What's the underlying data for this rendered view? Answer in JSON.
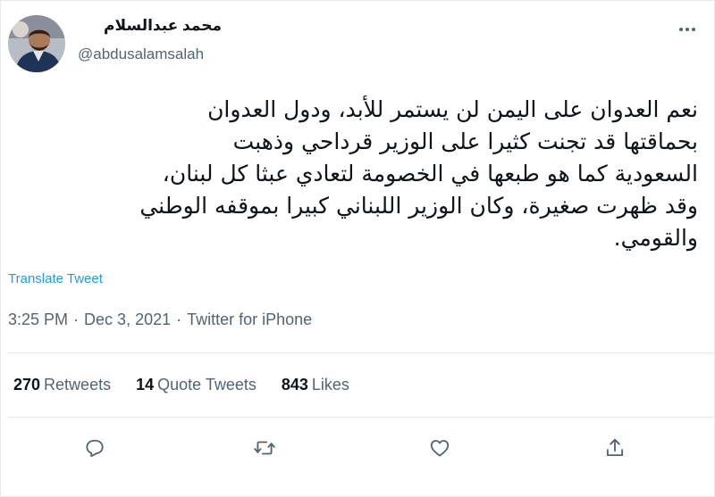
{
  "author": {
    "display_name": "محمد عبدالسلام",
    "handle": "@abdusalamsalah"
  },
  "tweet": {
    "text": "نعم العدوان على اليمن لن يستمر للأبد، ودول العدوان\nبحماقتها قد تجنت كثيرا على الوزير قرداحي وذهبت\nالسعودية كما هو طبعها في الخصومة لتعادي عبثا كل لبنان،\nوقد ظهرت صغيرة، وكان الوزير اللبناني كبيرا بموقفه الوطني\nوالقومي.",
    "translate_label": "Translate Tweet",
    "time": "3:25 PM",
    "date": "Dec 3, 2021",
    "client": "Twitter for iPhone",
    "separator": "·"
  },
  "stats": {
    "retweets_count": "270",
    "retweets_label": "Retweets",
    "quotes_count": "14",
    "quotes_label": "Quote Tweets",
    "likes_count": "843",
    "likes_label": "Likes"
  },
  "icons": {
    "reply": "reply-icon",
    "retweet": "retweet-icon",
    "like": "like-icon",
    "share": "share-icon",
    "more": "more-icon"
  },
  "colors": {
    "link": "#1d9bf0",
    "secondary_text": "#536471",
    "primary_text": "#0f1419",
    "divider": "#e7e9ea"
  }
}
